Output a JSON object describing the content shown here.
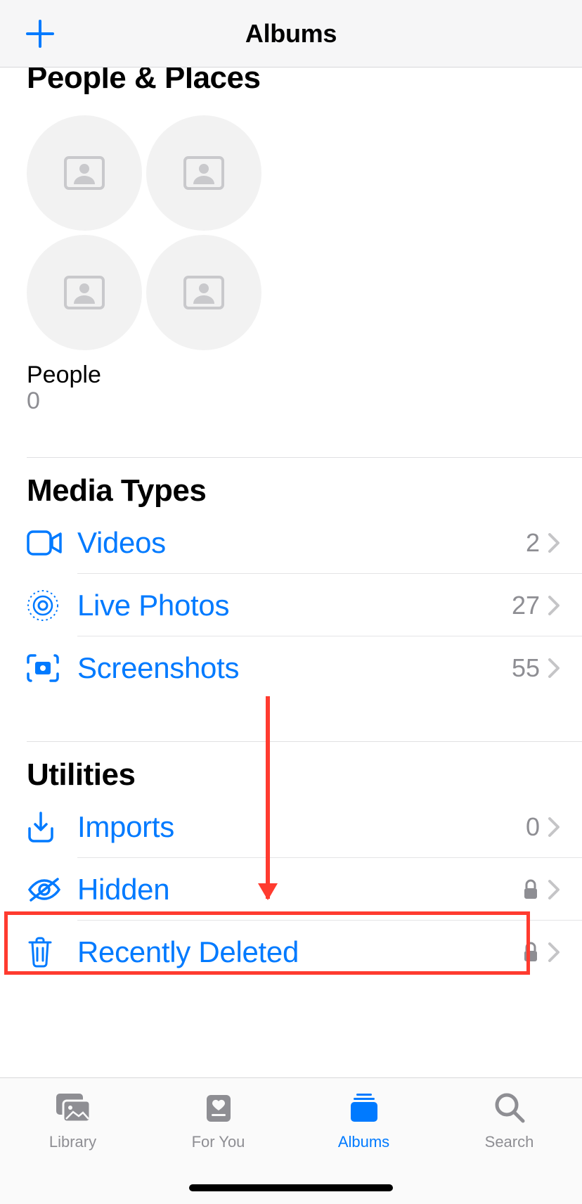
{
  "nav": {
    "title": "Albums"
  },
  "sections": {
    "people_places": {
      "title": "People & Places",
      "people_label": "People",
      "people_count": "0"
    },
    "media_types": {
      "title": "Media Types",
      "items": [
        {
          "label": "Videos",
          "count": "2"
        },
        {
          "label": "Live Photos",
          "count": "27"
        },
        {
          "label": "Screenshots",
          "count": "55"
        }
      ]
    },
    "utilities": {
      "title": "Utilities",
      "items": [
        {
          "label": "Imports",
          "count": "0",
          "locked": false
        },
        {
          "label": "Hidden",
          "count": "",
          "locked": true
        },
        {
          "label": "Recently Deleted",
          "count": "",
          "locked": true
        }
      ]
    }
  },
  "tabs": {
    "library": "Library",
    "foryou": "For You",
    "albums": "Albums",
    "search": "Search"
  }
}
